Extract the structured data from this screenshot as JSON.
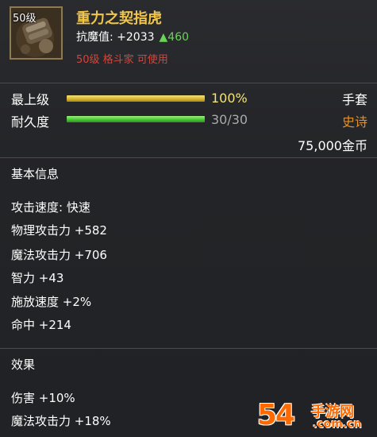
{
  "item": {
    "level_badge": "50级",
    "name": "重力之契指虎",
    "stat_prefix": "抗魔值: +2033",
    "stat_up": "▲460",
    "requirement": "50级 格斗家 可使用"
  },
  "grade": {
    "label": "最上级",
    "percent_text": "100%",
    "fill_fraction": 1.0,
    "type": "手套"
  },
  "durability": {
    "label": "耐久度",
    "value_text": "30/30",
    "fill_fraction": 1.0,
    "rarity": "史诗"
  },
  "price": "75,000金币",
  "basic_info": {
    "title": "基本信息",
    "lines": [
      "攻击速度: 快速",
      "物理攻击力 +582",
      "魔法攻击力 +706",
      "智力 +43",
      "施放速度 +2%",
      "命中 +214"
    ]
  },
  "effects": {
    "title": "效果",
    "lines": [
      "伤害 +10%",
      "魔法攻击力 +18%"
    ]
  },
  "watermark": {
    "digits": "54",
    "cn": "手游网",
    "domain": ".com.cn"
  },
  "colors": {
    "item_name": "#f0c54a",
    "stat_up": "#6bd25a",
    "requirement": "#d5453c",
    "rarity": "#e0902a",
    "percent": "#f4e27a",
    "durability_value": "#aaaaaa"
  }
}
